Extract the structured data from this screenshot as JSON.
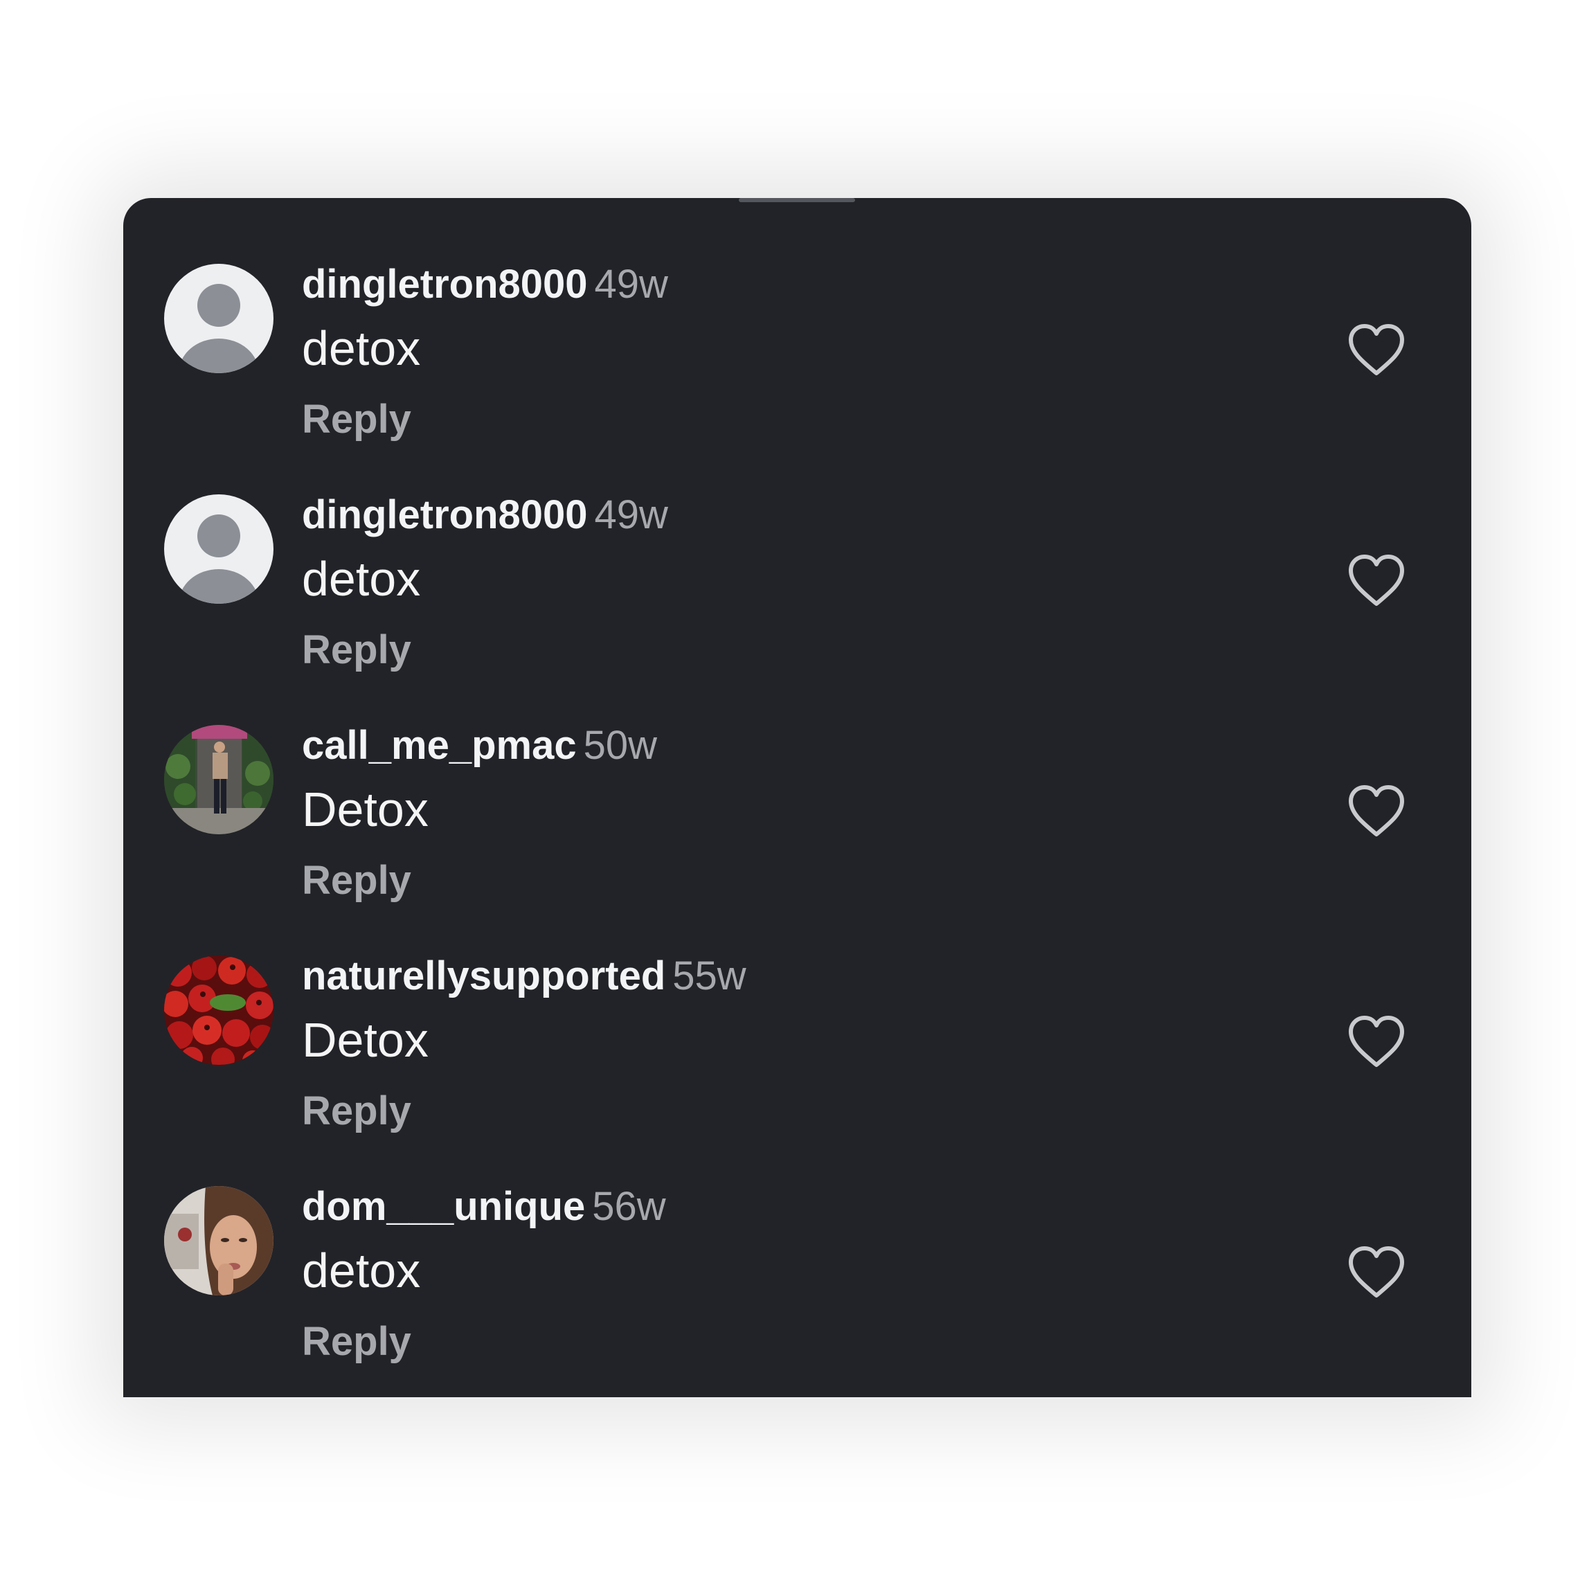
{
  "comments": [
    {
      "username": "dingletron8000",
      "time": "49w",
      "text": "detox",
      "reply_label": "Reply",
      "avatar": "default-avatar",
      "like_icon": "heart-outline-icon"
    },
    {
      "username": "dingletron8000",
      "time": "49w",
      "text": "detox",
      "reply_label": "Reply",
      "avatar": "default-avatar",
      "like_icon": "heart-outline-icon"
    },
    {
      "username": "call_me_pmac",
      "time": "50w",
      "text": "Detox",
      "reply_label": "Reply",
      "avatar": "photo-person-outdoors",
      "like_icon": "heart-outline-icon"
    },
    {
      "username": "naturellysupported",
      "time": "55w",
      "text": "Detox",
      "reply_label": "Reply",
      "avatar": "photo-red-berries",
      "like_icon": "heart-outline-icon"
    },
    {
      "username": "dom___unique",
      "time": "56w",
      "text": "detox",
      "reply_label": "Reply",
      "avatar": "photo-selfie",
      "like_icon": "heart-outline-icon"
    }
  ],
  "colors": {
    "sheet_background": "#222328",
    "username": "#f3f4f6",
    "secondary_text": "#a6a8ad",
    "heart_outline": "#c9cacd"
  }
}
